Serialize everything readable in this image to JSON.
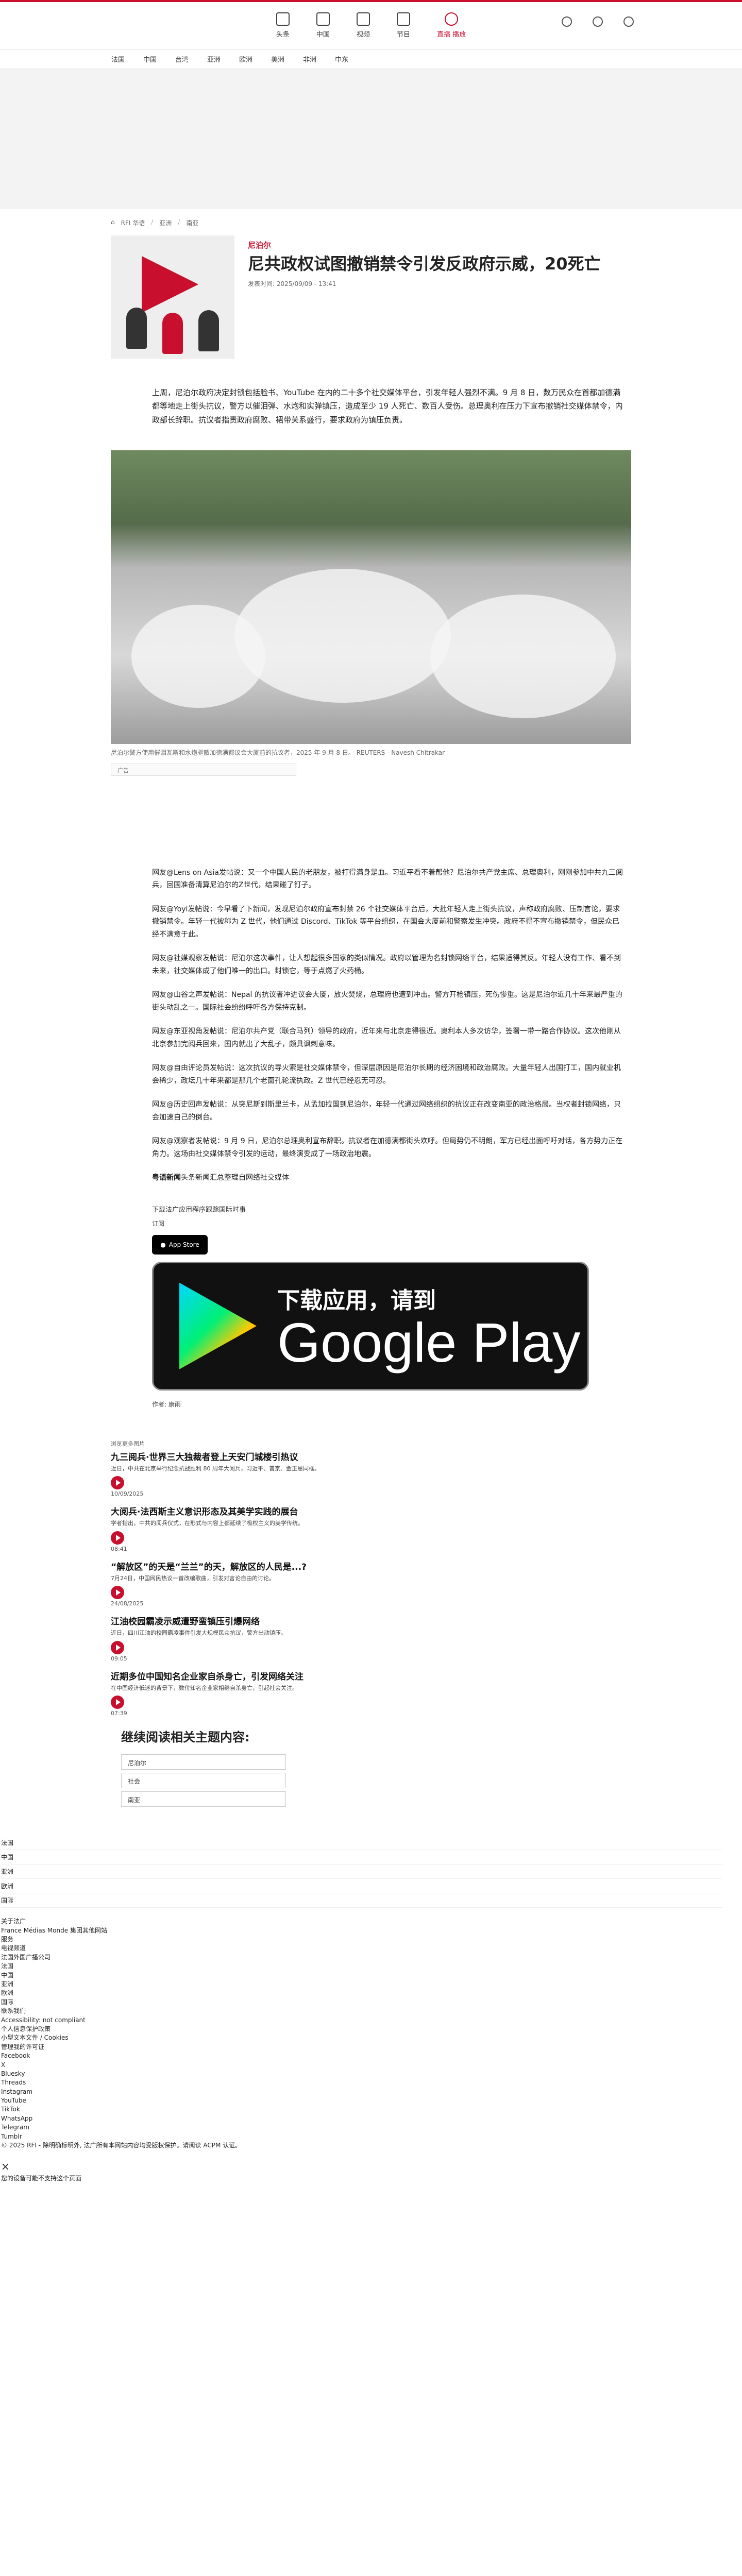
{
  "nav": {
    "items": [
      {
        "label": "头条",
        "icon": "home-icon"
      },
      {
        "label": "中国",
        "icon": "lantern-icon"
      },
      {
        "label": "视频",
        "icon": "video-icon"
      },
      {
        "label": "节目",
        "icon": "podcast-icon"
      }
    ],
    "live": "直播 播放",
    "right_icons": [
      "translate-icon",
      "search-icon",
      "settings-icon"
    ]
  },
  "subnav": [
    "法国",
    "中国",
    "台湾",
    "亚洲",
    "欧洲",
    "美洲",
    "非洲",
    "中东"
  ],
  "breadcrumb": [
    "RFI 华语",
    "亚洲",
    "南亚"
  ],
  "article": {
    "kicker": "尼泊尔",
    "title": "尼共政权试图撤销禁令引发反政府示威，20死亡",
    "date": "发表时间: 2025/09/09 - 13:41",
    "lead": "上周，尼泊尔政府决定封锁包括脸书、YouTube 在内的二十多个社交媒体平台，引发年轻人强烈不满。9 月 8 日，数万民众在首都加德满都等地走上街头抗议，警方以催泪弹、水炮和实弹镇压，造成至少 19 人死亡、数百人受伤。总理奥利在压力下宣布撤销社交媒体禁令，内政部长辞职。抗议者指责政府腐败、裙带关系盛行，要求政府为镇压负责。",
    "photo_caption": "尼泊尔警方使用催泪瓦斯和水炮驱散加德满都议会大厦前的抗议者，2025 年 9 月 8 日。 REUTERS - Navesh Chitrakar",
    "ad_label": "广告",
    "paragraphs": [
      "网友@Lens on Asia发帖说：又一个中国人民的老朋友，被打得满身是血。习近平看不着帮他？尼泊尔共产党主席、总理奥利，刚刚参加中共九三阅兵，回国准备清算尼泊尔的Z世代，结果碰了钉子。",
      "网友@Yoyi发帖说：今早看了下新闻，发现尼泊尔政府宣布封禁 26 个社交媒体平台后，大批年轻人走上街头抗议，声称政府腐败、压制言论，要求撤销禁令。年轻一代被称为 Z 世代，他们通过 Discord、TikTok 等平台组织，在国会大厦前和警察发生冲突。政府不得不宣布撤销禁令，但民众已经不满意于此。",
      "网友@社媒观察发帖说：尼泊尔这次事件，让人想起很多国家的类似情况。政府以管理为名封锁网络平台，结果适得其反。年轻人没有工作、看不到未来，社交媒体成了他们唯一的出口。封锁它，等于点燃了火药桶。",
      "网友@山谷之声发帖说：Nepal 的抗议者冲进议会大厦，放火焚烧，总理府也遭到冲击。警方开枪镇压，死伤惨重。这是尼泊尔近几十年来最严重的街头动乱之一。国际社会纷纷呼吁各方保持克制。",
      "网友@东亚视角发帖说：尼泊尔共产党（联合马列）领导的政府，近年来与北京走得很近。奥利本人多次访华，签署一带一路合作协议。这次他刚从北京参加完阅兵回来，国内就出了大乱子，颇具讽刺意味。",
      "网友@自由评论员发帖说：这次抗议的导火索是社交媒体禁令，但深层原因是尼泊尔长期的经济困境和政治腐败。大量年轻人出国打工，国内就业机会稀少，政坛几十年来都是那几个老面孔轮流执政。Z 世代已经忍无可忍。",
      "网友@历史回声发帖说：从突尼斯到斯里兰卡，从孟加拉国到尼泊尔，年轻一代通过网络组织的抗议正在改变南亚的政治格局。当权者封锁网络，只会加速自己的倒台。",
      "网友@观察者发帖说：9 月 9 日，尼泊尔总理奥利宣布辞职。抗议者在加德满都街头欢呼。但局势仍不明朗，军方已经出面呼吁对话，各方势力正在角力。这场由社交媒体禁令引发的运动，最终演变成了一场政治地震。"
    ],
    "signature": "粤语新闻",
    "signature_rest": "头条新闻汇总整理自网络社交媒体",
    "cta": "下载法广应用程序跟踪国际时事",
    "tag": "订阅",
    "appstore": "App Store",
    "gplay_line1": "下载应用，请到",
    "gplay_line2": "Google Play",
    "author": "作者: 康雨"
  },
  "related": {
    "label": "浏览更多",
    "items": [
      {
        "cat": "浏览更多图片",
        "title": "九三阅兵·世界三大独裁者登上天安门城楼引热议",
        "desc": "近日，中共在北京举行纪念抗战胜利 80 周年大阅兵，习近平、普京、金正恩同框。",
        "time": "10/09/2025"
      },
      {
        "cat": "浏览更多图片",
        "title": "大阅兵·法西斯主义意识形态及其美学实践的展台",
        "desc": "学者指出，中共的阅兵仪式，在形式与内容上都延续了极权主义的美学传统。",
        "time": "08:41"
      },
      {
        "cat": "浏览更多图片",
        "title": "“解放区”的天是“兰兰”的天，解放区的人民是...?",
        "desc": "7月24日，中国网民热议一首改编歌曲，引发对言论自由的讨论。",
        "time": "24/08/2025"
      },
      {
        "cat": "浏览更多图片",
        "title": "江油校园霸凌示威遭野蛮镇压引爆网络",
        "desc": "近日，四川江油的校园霸凌事件引发大规模民众抗议，警方出动镇压。",
        "time": "09:05"
      },
      {
        "cat": "浏览更多图片",
        "title": "近期多位中国知名企业家自杀身亡，引发网络关注",
        "desc": "在中国经济低迷的背景下，数位知名企业家相继自杀身亡，引起社会关注。",
        "time": "07:39"
      }
    ]
  },
  "more": {
    "heading": "继续阅读相关主题内容:",
    "topics": [
      "尼泊尔",
      "社会",
      "南亚"
    ]
  },
  "footer": {
    "rows": [
      "法国",
      "中国",
      "亚洲",
      "欧洲",
      "国际"
    ],
    "lines": [
      "关于法广",
      "France Médias Monde 集团其他网站",
      "服务",
      "电视频道",
      "法国外国广播公司",
      "法国",
      "中国",
      "亚洲",
      "欧洲",
      "国际",
      "联系我们",
      "Accessibility: not compliant",
      "个人信息保护政策",
      "小型文本文件 / Cookies",
      "管理我的许可证",
      "Facebook",
      "X",
      "Bluesky",
      "Threads",
      "Instagram",
      "YouTube",
      "TikTok",
      "WhatsApp",
      "Telegram",
      "Tumblr",
      "© 2025 RFI - 除明确标明外, 法广所有本网站内容均受版权保护。请阅读 ACPM 认证。"
    ],
    "close": "×",
    "close_text": "您的设备可能不支持这个页面"
  }
}
